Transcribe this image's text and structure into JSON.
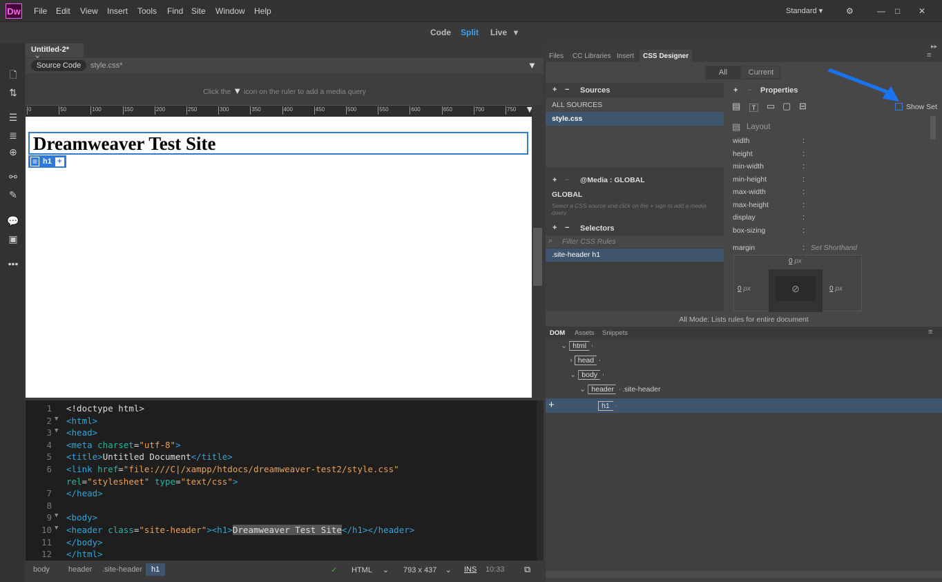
{
  "app": {
    "logo": "Dw",
    "menu": [
      "File",
      "Edit",
      "View",
      "Insert",
      "Tools",
      "Find",
      "Site",
      "Window",
      "Help"
    ],
    "workspace": "Standard"
  },
  "views": {
    "code": "Code",
    "split": "Split",
    "live": "Live"
  },
  "document": {
    "tab": "Untitled-2*",
    "related_files": [
      "Source Code",
      "style.css*"
    ],
    "media_hint_before": "Click the",
    "media_hint_after": "icon on the ruler to add a media query",
    "ruler": [
      "0",
      "50",
      "100",
      "150",
      "200",
      "250",
      "300",
      "350",
      "400",
      "450",
      "500",
      "550",
      "600",
      "650",
      "700",
      "750"
    ],
    "heading": "Dreamweaver Test Site",
    "element_tag": "h1"
  },
  "code_lines": [
    {
      "n": "1",
      "fold": "",
      "tokens": [
        [
          "<!doctype html>",
          "t-txt"
        ]
      ]
    },
    {
      "n": "2",
      "fold": "▼",
      "tokens": [
        [
          "<html>",
          "t-tag"
        ]
      ]
    },
    {
      "n": "3",
      "fold": "▼",
      "tokens": [
        [
          "<head>",
          "t-tag"
        ]
      ]
    },
    {
      "n": "4",
      "fold": "",
      "tokens": [
        [
          "<meta ",
          "t-tag"
        ],
        [
          "charset",
          "t-attr"
        ],
        [
          "=",
          "t-txt"
        ],
        [
          "\"utf-8\"",
          "t-val"
        ],
        [
          ">",
          "t-tag"
        ]
      ]
    },
    {
      "n": "5",
      "fold": "",
      "tokens": [
        [
          "<title>",
          "t-tag"
        ],
        [
          "Untitled Document",
          "t-txt"
        ],
        [
          "</title>",
          "t-tag"
        ]
      ]
    },
    {
      "n": "6",
      "fold": "",
      "tokens": [
        [
          "<link ",
          "t-tag"
        ],
        [
          "href",
          "t-attr"
        ],
        [
          "=",
          "t-txt"
        ],
        [
          "\"file:///C|/xampp/htdocs/dreamweaver-test2/style.css\"",
          "t-val"
        ]
      ]
    },
    {
      "n": "",
      "fold": "",
      "tokens": [
        [
          "rel",
          "t-attr"
        ],
        [
          "=",
          "t-txt"
        ],
        [
          "\"stylesheet\"",
          "t-val"
        ],
        [
          " type",
          "t-attr"
        ],
        [
          "=",
          "t-txt"
        ],
        [
          "\"text/css\"",
          "t-val"
        ],
        [
          ">",
          "t-tag"
        ]
      ]
    },
    {
      "n": "7",
      "fold": "",
      "tokens": [
        [
          "</head>",
          "t-tag"
        ]
      ]
    },
    {
      "n": "8",
      "fold": "",
      "tokens": []
    },
    {
      "n": "9",
      "fold": "▼",
      "tokens": [
        [
          "<body>",
          "t-tag"
        ]
      ]
    },
    {
      "n": "10",
      "fold": "▼",
      "tokens": [
        [
          "<header ",
          "t-tag"
        ],
        [
          "class",
          "t-attr"
        ],
        [
          "=",
          "t-txt"
        ],
        [
          "\"site-header\"",
          "t-val"
        ],
        [
          "><h1>",
          "t-tag"
        ],
        [
          "Dreamweaver Test Site",
          "t-sel"
        ],
        [
          "</h1></header>",
          "t-tag"
        ]
      ]
    },
    {
      "n": "11",
      "fold": "",
      "tokens": [
        [
          "</body>",
          "t-tag"
        ]
      ]
    },
    {
      "n": "12",
      "fold": "",
      "tokens": [
        [
          "</html>",
          "t-tag"
        ]
      ]
    }
  ],
  "status": {
    "breadcrumbs": [
      "body",
      "header",
      ".site-header",
      "h1"
    ],
    "doc_type": "HTML",
    "size": "793 x 437",
    "mode": "INS",
    "cursor": "10:33"
  },
  "panel": {
    "tabs": [
      "Files",
      "CC Libraries",
      "Insert",
      "CSS Designer"
    ],
    "modes": [
      "All",
      "Current"
    ],
    "sources_title": "Sources",
    "sources": [
      "ALL SOURCES",
      "style.css"
    ],
    "media_title": "@Media :  GLOBAL",
    "media_item": "GLOBAL",
    "media_hint": "Select a CSS source and click on the + sign to add a media query.",
    "selectors_title": "Selectors",
    "filter_placeholder": "Filter CSS Rules",
    "selectors": [
      ".site-header h1"
    ],
    "properties_title": "Properties",
    "show_set": "Show Set",
    "layout_title": "Layout",
    "props": [
      "width",
      "height",
      "min-width",
      "min-height",
      "max-width",
      "max-height",
      "display",
      "box-sizing"
    ],
    "margin_label": "margin",
    "margin_shorthand": "Set Shorthand",
    "margin_top": "0",
    "margin_left": "0",
    "margin_right": "0",
    "unit": "px",
    "mode_status": "All Mode: Lists rules for entire document"
  },
  "dom": {
    "tabs": [
      "DOM",
      "Assets",
      "Snippets"
    ],
    "header_class": ".site-header",
    "nodes": [
      "html",
      "head",
      "body",
      "header",
      "h1"
    ]
  },
  "colors": {
    "accent": "#2f7ad6",
    "selection": "#3f556e",
    "arrow": "#1a73f0"
  }
}
